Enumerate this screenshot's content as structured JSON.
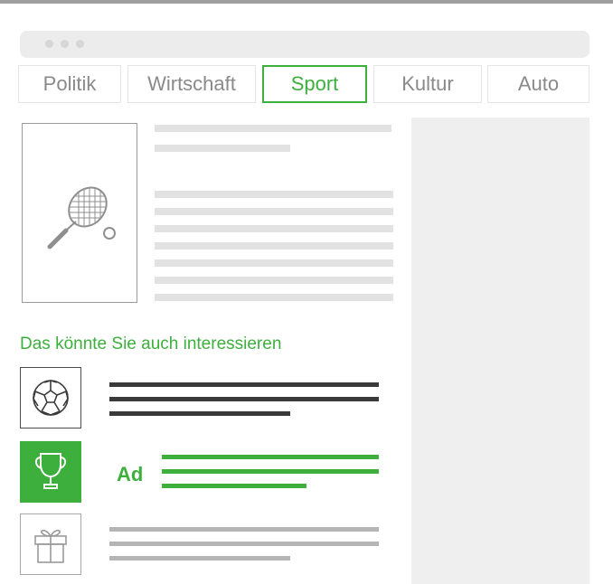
{
  "tabs": [
    "Politik",
    "Wirtschaft",
    "Sport",
    "Kultur",
    "Auto"
  ],
  "active_tab": "Sport",
  "recommendations": {
    "heading": "Das könnte Sie auch interessieren",
    "ad_label": "Ad"
  },
  "colors": {
    "accent": "#3daf3d",
    "placeholder_line": "#e2e2e2",
    "sidebar": "#efefef"
  },
  "icons": {
    "hero": "tennis-racket-icon",
    "item1": "football-icon",
    "item2": "trophy-icon",
    "item3": "gift-icon"
  }
}
